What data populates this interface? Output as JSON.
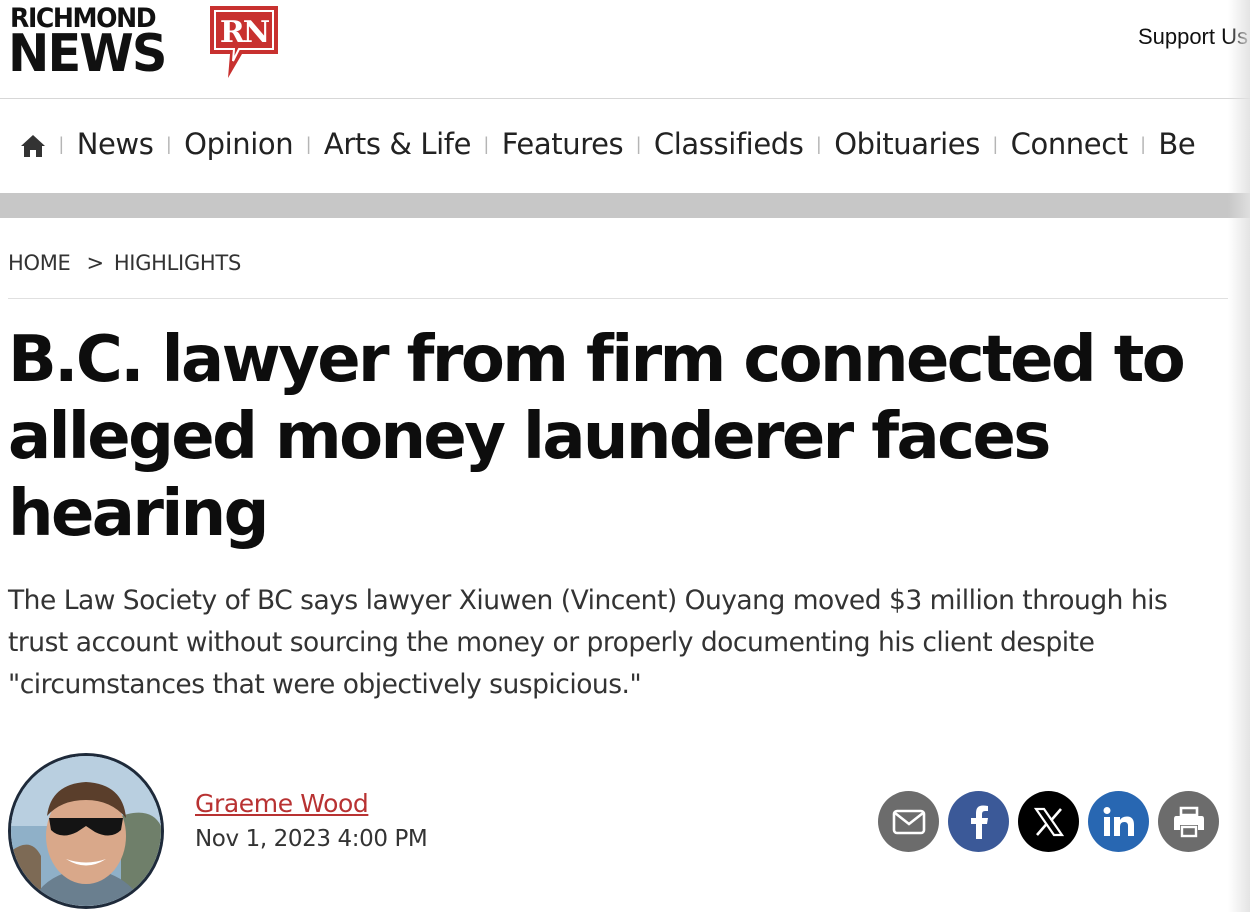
{
  "header": {
    "logo_top": "RICHMOND",
    "logo_bottom": "NEWS",
    "logo_mark": "RN",
    "support_label": "Support Us"
  },
  "nav": {
    "home_icon": "home-icon",
    "items": [
      "News",
      "Opinion",
      "Arts & Life",
      "Features",
      "Classifieds",
      "Obituaries",
      "Connect",
      "Be"
    ]
  },
  "breadcrumb": {
    "home": "HOME",
    "separator": ">",
    "section": "HIGHLIGHTS"
  },
  "article": {
    "headline": "B.C. lawyer from firm connected to alleged money launderer faces hearing",
    "dek": "The Law Society of BC says lawyer Xiuwen (Vincent) Ouyang moved $3 million through his trust account without sourcing the money or properly documenting his client despite \"circumstances that were objectively suspicious.\"",
    "author": "Graeme Wood",
    "date": "Nov 1, 2023 4:00 PM"
  },
  "share": {
    "icons": [
      "email-icon",
      "facebook-icon",
      "x-icon",
      "linkedin-icon",
      "print-icon"
    ]
  },
  "colors": {
    "brand_red": "#c8312f",
    "author_link": "#b83232",
    "facebook": "#3b5998",
    "linkedin": "#2867b2",
    "grey_button": "#6c6c6c"
  }
}
